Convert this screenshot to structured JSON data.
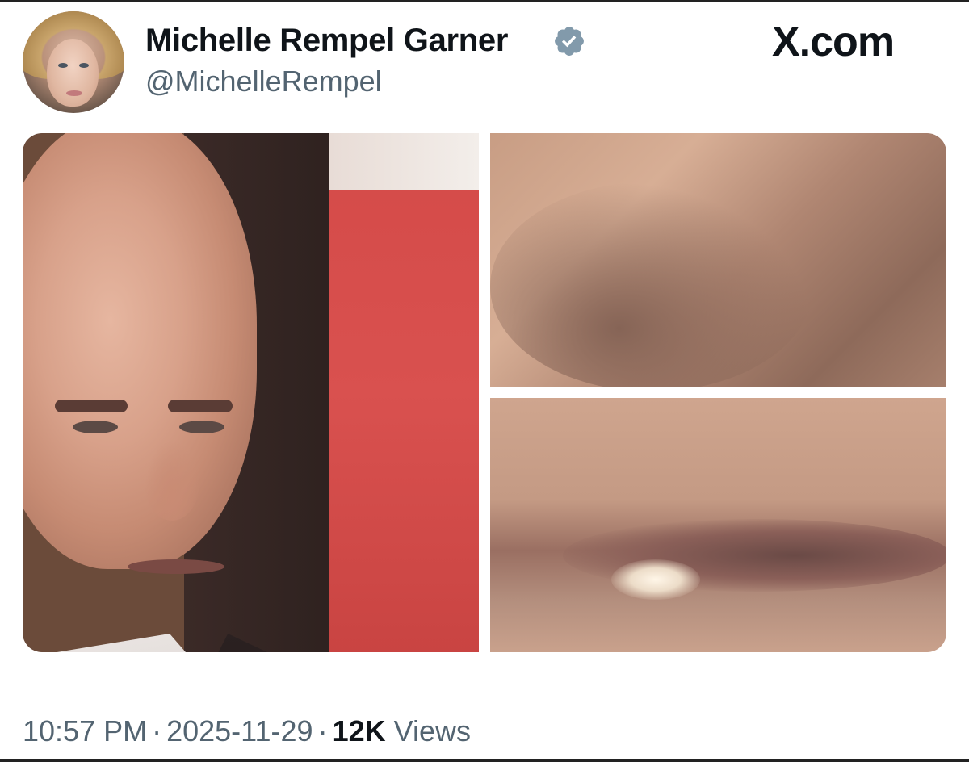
{
  "post": {
    "author": {
      "display_name": "Michelle Rempel Garner",
      "handle": "@MichelleRempel",
      "verified": true,
      "verified_color": "#829aab"
    },
    "brand": {
      "label": "X.com"
    },
    "media": [
      {
        "name": "photo-speaker-portrait"
      },
      {
        "name": "photo-closeup-top"
      },
      {
        "name": "photo-closeup-bottom"
      }
    ],
    "meta": {
      "time": "10:57 PM",
      "separator": "·",
      "date": "2025-11-29",
      "views_count": "12K",
      "views_label": "Views"
    }
  },
  "colors": {
    "text_primary": "#0f1419",
    "text_secondary": "#536471"
  }
}
